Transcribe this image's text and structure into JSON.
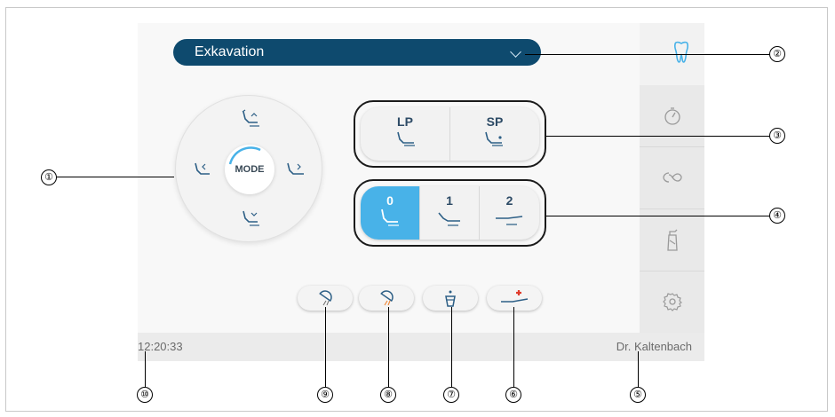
{
  "program": {
    "selected": "Exkavation"
  },
  "wheel": {
    "center_label": "MODE"
  },
  "lp_sp": [
    "LP",
    "SP"
  ],
  "positions": [
    {
      "label": "0",
      "active": true
    },
    {
      "label": "1",
      "active": false
    },
    {
      "label": "2",
      "active": false
    }
  ],
  "status": {
    "time": "12:20:33",
    "user": "Dr. Kaltenbach"
  },
  "sidebar": {
    "items": [
      "tooth-icon",
      "timer-icon",
      "infinity-icon",
      "spray-bottle-icon",
      "gear-icon"
    ]
  },
  "callouts": [
    "①",
    "②",
    "③",
    "④",
    "⑤",
    "⑥",
    "⑦",
    "⑧",
    "⑨",
    "⑩"
  ],
  "colors": {
    "dark_blue": "#0e4a6e",
    "accent_blue": "#48b2e8",
    "icon_blue": "#2d5f86"
  }
}
